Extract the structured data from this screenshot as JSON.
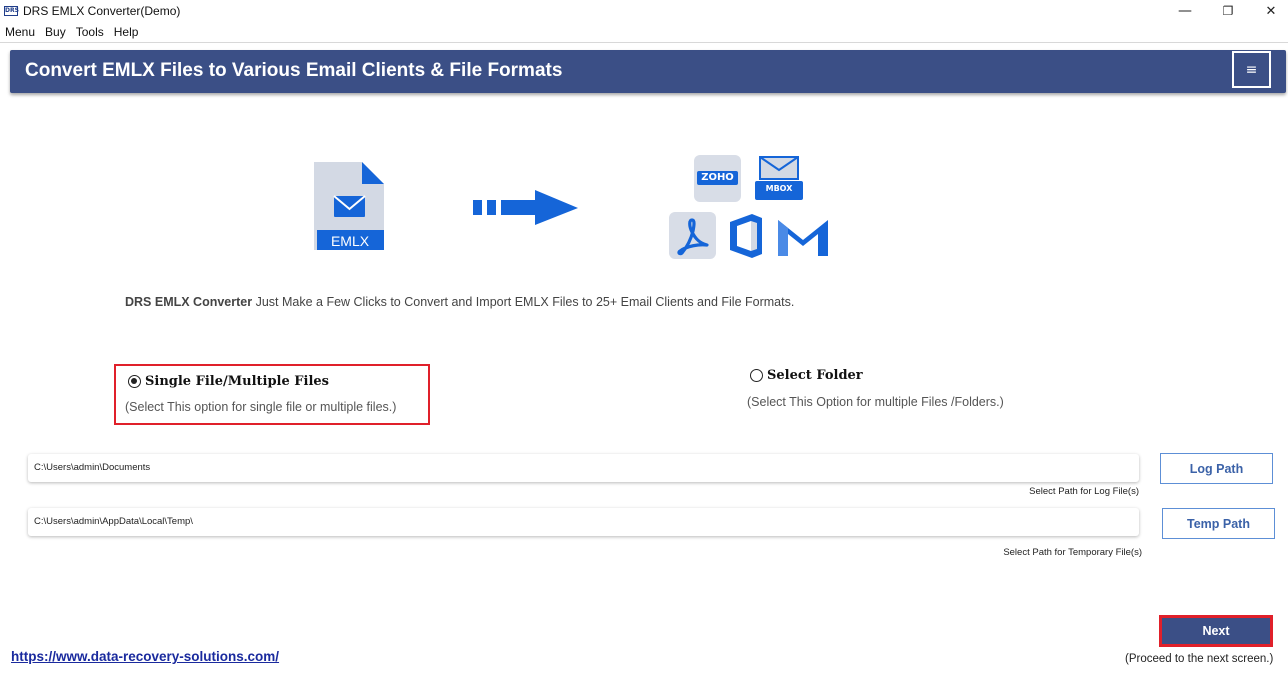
{
  "window": {
    "title": "DRS EMLX Converter(Demo)",
    "app_icon_text": "DRS",
    "minimize_glyph": "—",
    "restore_glyph": "❐",
    "close_glyph": "✕"
  },
  "menu": {
    "items": [
      {
        "label": "Menu"
      },
      {
        "label": "Buy"
      },
      {
        "label": "Tools"
      },
      {
        "label": "Help"
      }
    ]
  },
  "banner": {
    "title": "Convert EMLX Files to Various Email Clients & File Formats",
    "menu_glyph": "≡",
    "background": "#3b4f86"
  },
  "illustration": {
    "source_file_label": "EMLX",
    "target_icons": [
      "zoho-icon",
      "mbox-icon",
      "pdf-icon",
      "office365-icon",
      "gmail-icon"
    ],
    "zoho_label": "ZOHO",
    "mbox_label": "MBOX",
    "accent": "#1565d8"
  },
  "tagline": {
    "brand": "DRS EMLX Converter",
    "text": " Just Make a Few Clicks to Convert and Import EMLX Files to 25+ Email Clients and File Formats."
  },
  "options": {
    "single": {
      "label": "Single File/Multiple Files",
      "description": "(Select This option for single file or multiple files.)",
      "selected": true
    },
    "folder": {
      "label": "Select Folder",
      "description": "(Select This Option for multiple Files /Folders.)",
      "selected": false
    }
  },
  "paths": {
    "log": {
      "value": "C:\\Users\\admin\\Documents",
      "caption": "Select Path for Log File(s)",
      "button": "Log Path"
    },
    "temp": {
      "value": "C:\\Users\\admin\\AppData\\Local\\Temp\\",
      "caption": "Select Path for Temporary File(s)",
      "button": "Temp Path"
    }
  },
  "footer": {
    "link": "https://www.data-recovery-solutions.com/",
    "next_button": "Next",
    "next_hint": "(Proceed to the next screen.)"
  },
  "colors": {
    "highlight": "#e0202a",
    "primary": "#3b4f86",
    "link": "#1a2a9e"
  }
}
